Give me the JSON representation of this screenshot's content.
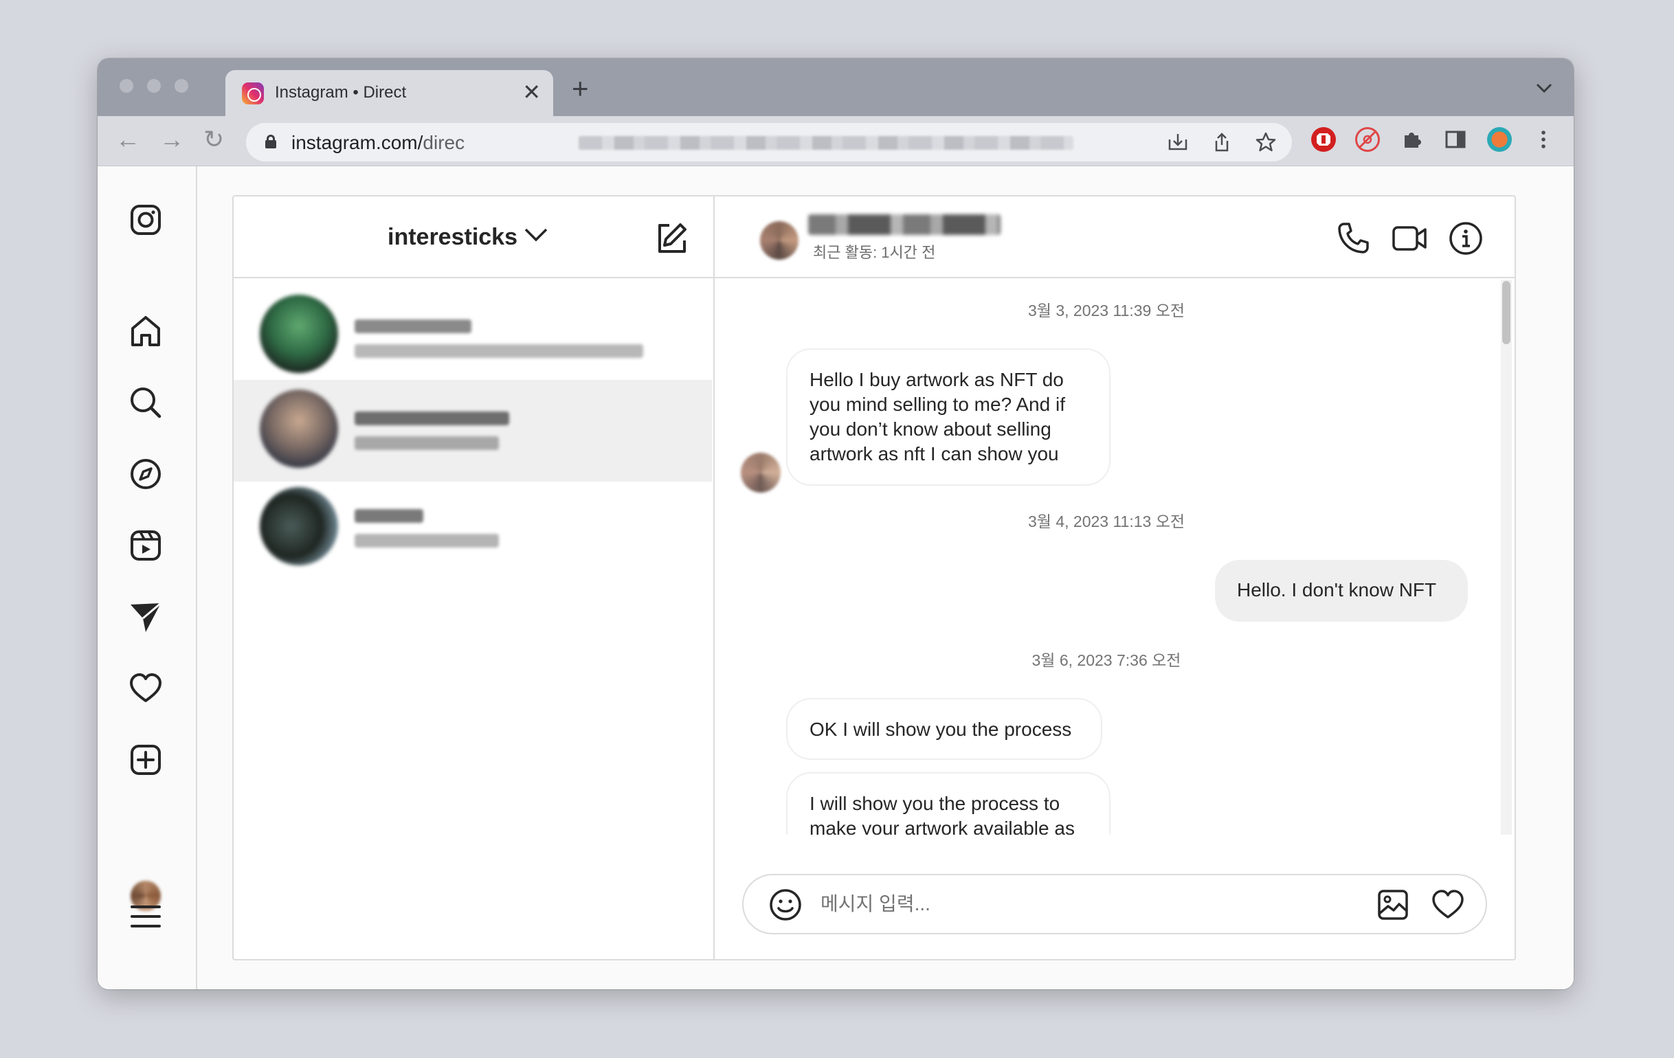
{
  "browser": {
    "tab_title": "Instagram • Direct",
    "tab_close": "✕",
    "new_tab": "+",
    "tab_menu": "⌄",
    "back": "←",
    "forward": "→",
    "reload": "↻",
    "url_host": "instagram.com/",
    "url_path": "direc",
    "icons": [
      "install-icon",
      "share-icon",
      "star-icon",
      "more-icon"
    ]
  },
  "sidebar": {
    "items": [
      "instagram-logo",
      "home",
      "search",
      "explore",
      "reels",
      "messages",
      "notifications",
      "create",
      "profile",
      "more"
    ]
  },
  "inbox": {
    "account_name": "interesticks",
    "threads": [
      {
        "selected": false
      },
      {
        "selected": true
      },
      {
        "selected": false
      }
    ]
  },
  "chat": {
    "status": "최근 활동: 1시간 전",
    "messages": {
      "ts1": "3월 3, 2023 11:39 오전",
      "m1_part1": "Hello ",
      "m1_highlight": "I buy artwork as NFT",
      "m1_part2": " do you mind selling to me? And if you don’t know about selling artwork as nft I can show you",
      "ts2": "3월 4, 2023 11:13 오전",
      "m2": "Hello. I don't know NFT",
      "ts3": "3월 6, 2023 7:36 오전",
      "m3": "OK I will show you the process",
      "m4": "I will show you the process to make your artwork available as"
    },
    "composer_placeholder": "메시지 입력..."
  }
}
